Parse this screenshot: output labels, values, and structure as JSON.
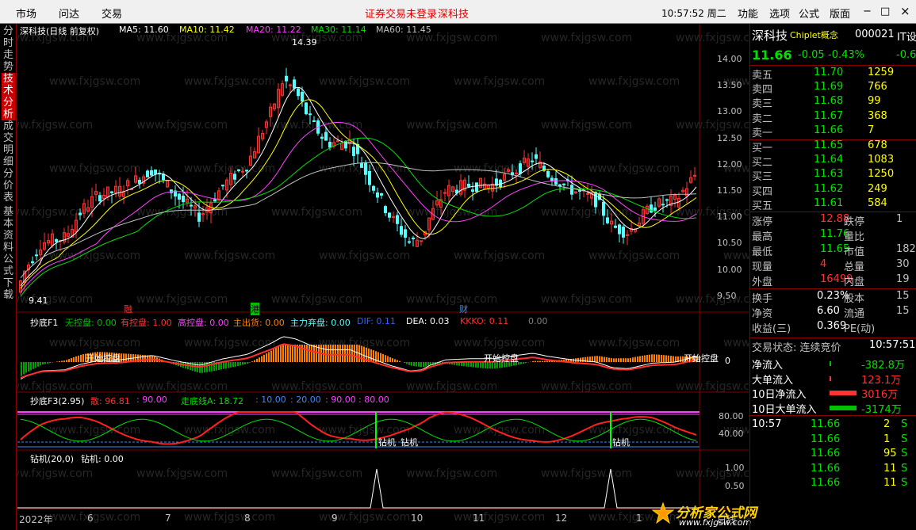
{
  "topbar": {
    "market": "市场",
    "wenda": "问达",
    "trade": "交易",
    "notice": "证券交易未登录",
    "stock": "深科技",
    "time": "10:57:52 周二",
    "func": "功能",
    "options": "选项",
    "formula": "公式",
    "layout": "版面",
    "minimize": "−",
    "maximize": "□",
    "close": "×"
  },
  "sidebar": [
    "分时走势",
    "技术分析",
    "成交明细",
    "分价表",
    "基本资料",
    "公式下载"
  ],
  "main": {
    "title": "深科技(日线 前复权)",
    "ma5": "MA5: 11.60",
    "ma10": "MA10: 11.42",
    "ma20": "MA20: 11.22",
    "ma30": "MA30: 11.14",
    "ma60": "MA60: 11.45",
    "high": "14.39",
    "low": "9.41",
    "yticks": [
      "14.00",
      "13.50",
      "13.00",
      "12.50",
      "12.00",
      "11.50",
      "11.00",
      "10.50",
      "10.00",
      "9.50"
    ],
    "events": [
      "融",
      "港",
      "财"
    ]
  },
  "p1": {
    "title": "抄底F1",
    "a": "无控盘: 0.00",
    "b": "有控盘: 1.00",
    "c": "高控盘: 0.00",
    "d": "主出货: 0.00",
    "e": "主力弃盘: 0.00",
    "f": "DIF: 0.11",
    "g": "DEA: 0.03",
    "h": "KKKO: 0.11",
    "i": "0.00",
    "ann": "开始控盘",
    "yt": "0"
  },
  "p2": {
    "title": "抄底F3(2.95)",
    "a": "散: 96.81",
    "b": ": 90.00",
    "c": "走底线A: 18.72",
    "d": ": 10.00",
    "e": ": 20.00",
    "f": ": 90.00",
    "g": ": 80.00",
    "ann1": "钻机",
    "ann2": "钻机",
    "y1": "80.00",
    "y2": "40.00"
  },
  "p3": {
    "title": "钻机(20,0)",
    "a": "钻机: 0.00",
    "y1": "1.00",
    "y2": "0.50"
  },
  "xaxis": {
    "labels": [
      "2022年",
      "6",
      "7",
      "8",
      "9",
      "10",
      "11",
      "12",
      "1"
    ],
    "mode": "日线"
  },
  "watermark": {
    "text1": "分析家公式网",
    "text2": "www.fxjgsw.com"
  },
  "quote": {
    "name": "深科技",
    "concept": "Chiplet概念",
    "code": "000021",
    "tag": "IT设",
    "price": "11.66",
    "change": "-0.05",
    "pct": "-0.43%",
    "ext": "-0.6",
    "asks": [
      {
        "l": "卖五",
        "p": "11.70",
        "v": "1259"
      },
      {
        "l": "卖四",
        "p": "11.69",
        "v": "766"
      },
      {
        "l": "卖三",
        "p": "11.68",
        "v": "99"
      },
      {
        "l": "卖二",
        "p": "11.67",
        "v": "368"
      },
      {
        "l": "卖一",
        "p": "11.66",
        "v": "7"
      }
    ],
    "bids": [
      {
        "l": "买一",
        "p": "11.65",
        "v": "678"
      },
      {
        "l": "买二",
        "p": "11.64",
        "v": "1083"
      },
      {
        "l": "买三",
        "p": "11.63",
        "v": "1250"
      },
      {
        "l": "买四",
        "p": "11.62",
        "v": "249"
      },
      {
        "l": "买五",
        "p": "11.61",
        "v": "584"
      }
    ],
    "stats": [
      {
        "l": "涨停",
        "v": "12.88",
        "l2": "跌停",
        "v2": "1"
      },
      {
        "l": "最高",
        "v": "11.76",
        "l2": "量比",
        "v2": ""
      },
      {
        "l": "最低",
        "v": "11.65",
        "l2": "市值",
        "v2": "182"
      },
      {
        "l": "现量",
        "v": "4",
        "l2": "总量",
        "v2": "30"
      },
      {
        "l": "外盘",
        "v": "16499",
        "l2": "内盘",
        "v2": "19"
      }
    ],
    "stats2": [
      {
        "l": "换手",
        "v": "0.23%",
        "l2": "股本",
        "v2": "15"
      },
      {
        "l": "净资",
        "v": "6.60",
        "l2": "流通",
        "v2": "15"
      },
      {
        "l": "收益(三)",
        "v": "0.369",
        "l2": "PE(动)",
        "v2": ""
      }
    ],
    "status": "交易状态: 连续竞价",
    "status_time": "10:57:51",
    "flows": [
      {
        "l": "净流入",
        "v": "-382.8万"
      },
      {
        "l": "大单流入",
        "v": "123.1万"
      },
      {
        "l": "10日净流入",
        "v": "3016万"
      },
      {
        "l": "10日大单流入",
        "v": "-3174万"
      }
    ],
    "ticks": [
      {
        "t": "10:57",
        "p": "11.66",
        "v": "2",
        "s": "S"
      },
      {
        "t": "",
        "p": "11.66",
        "v": "1",
        "s": "S"
      },
      {
        "t": "",
        "p": "11.66",
        "v": "95",
        "s": "S"
      },
      {
        "t": "",
        "p": "11.66",
        "v": "11",
        "s": "S"
      },
      {
        "t": "",
        "p": "11.66",
        "v": "11",
        "s": "S"
      }
    ]
  },
  "colors": {
    "up": "#ff3232",
    "down": "#54ffff",
    "ma5": "#ffffff",
    "ma10": "#ffff00",
    "ma20": "#ff40ff",
    "ma30": "#00e000",
    "ma60": "#c0c0c0",
    "border": "#800000"
  }
}
